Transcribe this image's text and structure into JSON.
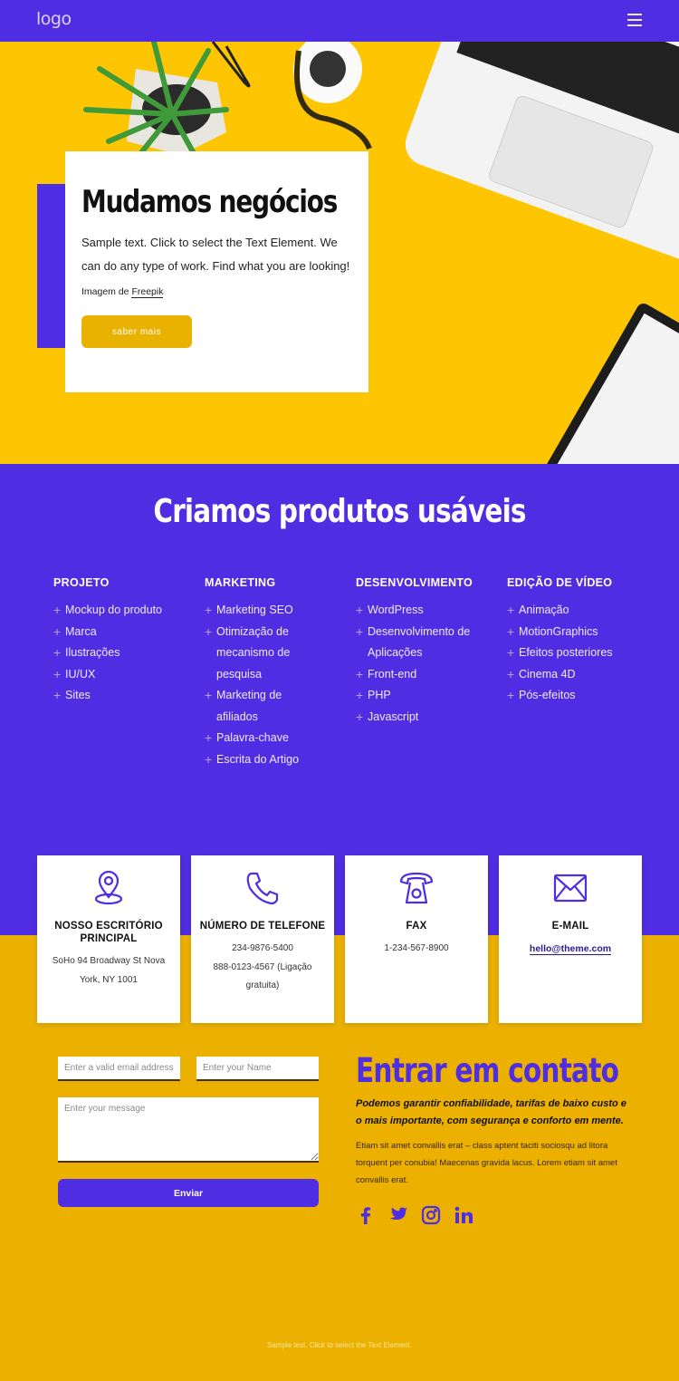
{
  "header": {
    "logo": "logo",
    "menu_icon": "hamburger-menu-icon"
  },
  "hero": {
    "title": "Mudamos negócios",
    "text": "Sample text. Click to select the Text Element. We can do any type of work. Find what you are looking!",
    "credit_prefix": "Imagem de",
    "credit_link": "Freepik",
    "button": "saber mais"
  },
  "services": {
    "title": "Criamos produtos usáveis",
    "columns": [
      {
        "heading": "PROJETO",
        "items": [
          "Mockup do produto",
          "Marca",
          "Ilustrações",
          "IU/UX",
          "Sites"
        ]
      },
      {
        "heading": "MARKETING",
        "items": [
          "Marketing SEO",
          "Otimização de mecanismo de pesquisa",
          "Marketing de afiliados",
          "Palavra-chave",
          "Escrita do Artigo"
        ]
      },
      {
        "heading": "DESENVOLVIMENTO",
        "items": [
          "WordPress",
          "Desenvolvimento de Aplicações",
          "Front-end",
          "PHP",
          "Javascript"
        ]
      },
      {
        "heading": "EDIÇÃO DE VÍDEO",
        "items": [
          "Animação",
          "MotionGraphics",
          "Efeitos posteriores",
          "Cinema 4D",
          "Pós-efeitos"
        ]
      }
    ]
  },
  "contact_cards": [
    {
      "icon": "location-pin-icon",
      "title": "NOSSO ESCRITÓRIO PRINCIPAL",
      "lines": [
        "SoHo 94 Broadway St Nova York, NY 1001"
      ]
    },
    {
      "icon": "phone-icon",
      "title": "NÚMERO DE TELEFONE",
      "lines": [
        "234-9876-5400",
        "888-0123-4567 (Ligação gratuita)"
      ]
    },
    {
      "icon": "fax-telephone-icon",
      "title": "FAX",
      "lines": [
        "1-234-567-8900"
      ]
    },
    {
      "icon": "envelope-icon",
      "title": "E-MAIL",
      "link": "hello@theme.com"
    }
  ],
  "form": {
    "email_placeholder": "Enter a valid email address",
    "name_placeholder": "Enter your Name",
    "message_placeholder": "Enter your message",
    "submit": "Enviar"
  },
  "contact": {
    "title": "Entrar em contato",
    "lead": "Podemos garantir confiabilidade, tarifas de baixo custo e o mais importante, com segurança e conforto em mente.",
    "body": "Etiam sit amet convallis erat – class aptent taciti sociosqu ad litora torquent per conubia! Maecenas gravida lacus. Lorem etiam sit amet convallis erat.",
    "socials": [
      "facebook-icon",
      "twitter-icon",
      "instagram-icon",
      "linkedin-icon"
    ]
  },
  "footer": {
    "text": "Sample text. Click to select the Text Element."
  },
  "colors": {
    "primary": "#4f2de2",
    "yellow": "#ebb000",
    "hero_yellow": "#fec502"
  }
}
